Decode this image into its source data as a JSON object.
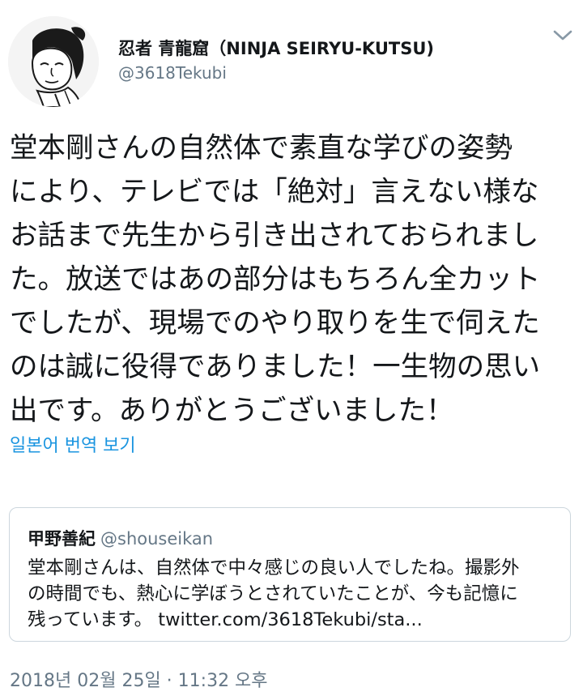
{
  "author": {
    "display_name": "忍者 青龍窟（NINJA SEIRYU-KUTSU)",
    "handle": "@3618Tekubi",
    "avatar_icon": "ninja-illustration-avatar"
  },
  "tweet": {
    "lines": [
      "堂本剛さんの自然体で素直な学びの姿勢",
      "により、テレビでは「絶対」言えない様な",
      "お話まで先生から引き出されておられまし",
      "た。放送ではあの部分はもちろん全カット",
      "でしたが、現場でのやり取りを生で伺えた",
      "のは誠に役得でありました！一生物の思い",
      "出です。ありがとうございました！"
    ],
    "translate_label": "일본어 번역 보기",
    "timestamp": "2018년 02월 25일 · 11:32 오후"
  },
  "quote": {
    "name": "甲野善紀",
    "handle": "@shouseikan",
    "lines": [
      "堂本剛さんは、自然体で中々感じの良い人でしたね。撮影外",
      "の時間でも、熱心に学ぼうとされていたことが、今も記憶に",
      "残っています。 twitter.com/3618Tekubi/sta..."
    ]
  },
  "colors": {
    "link": "#1b95e0",
    "secondary_text": "#657786",
    "border": "#ccd6dd"
  }
}
